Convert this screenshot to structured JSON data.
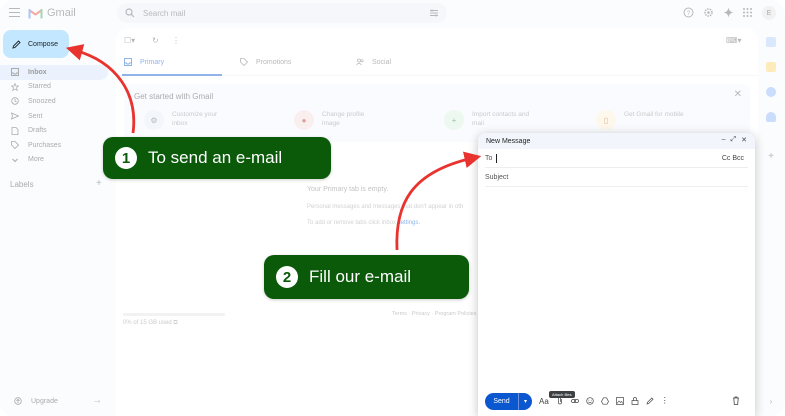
{
  "app": {
    "name": "Gmail",
    "avatar_letter": "E"
  },
  "search": {
    "placeholder": "Search mail"
  },
  "compose_button": {
    "label": "Compose"
  },
  "sidebar": {
    "items": [
      {
        "label": "Inbox",
        "icon": "inbox-icon",
        "active": true
      },
      {
        "label": "Starred",
        "icon": "star-icon"
      },
      {
        "label": "Snoozed",
        "icon": "clock-icon"
      },
      {
        "label": "Sent",
        "icon": "send-icon"
      },
      {
        "label": "Drafts",
        "icon": "draft-icon"
      },
      {
        "label": "Purchases",
        "icon": "tag-icon"
      },
      {
        "label": "More",
        "icon": "chevron-down-icon"
      }
    ],
    "labels_title": "Labels",
    "upgrade_label": "Upgrade"
  },
  "tabs": [
    {
      "label": "Primary",
      "icon": "inbox-icon"
    },
    {
      "label": "Promotions",
      "icon": "tag-icon"
    },
    {
      "label": "Social",
      "icon": "people-icon"
    }
  ],
  "getting_started": {
    "title": "Get started with Gmail",
    "items": [
      {
        "text": "Customize your inbox",
        "icon": "settings-icon"
      },
      {
        "text": "Change profile image",
        "icon": "profile-icon"
      },
      {
        "text": "Import contacts and mail",
        "icon": "contacts-icon"
      },
      {
        "text": "Get Gmail for mobile",
        "icon": "phone-icon"
      }
    ]
  },
  "empty_state": {
    "line1": "Your Primary tab is empty.",
    "line2": "Personal messages and messages that don't appear in oth",
    "line3_prefix": "To add or remove tabs click inbox ",
    "line3_link": "settings."
  },
  "storage": {
    "text": "0% of 15 GB used",
    "fraction_used": 0
  },
  "footer": {
    "text": "Terms · Privacy · Program Policies"
  },
  "compose_window": {
    "title": "New Message",
    "to_label": "To",
    "cc_bcc": "Cc Bcc",
    "subject_placeholder": "Subject",
    "send_label": "Send",
    "format_label": "Aa",
    "tooltip": "Attach files"
  },
  "annotations": [
    {
      "number": "1",
      "text": "To send an e-mail"
    },
    {
      "number": "2",
      "text": "Fill our e-mail"
    }
  ],
  "colors": {
    "annotation_green": "#0a5a0a",
    "arrow_red": "#e8332f",
    "compose_bg": "#c2e7ff",
    "accent_blue": "#0b57d0"
  }
}
